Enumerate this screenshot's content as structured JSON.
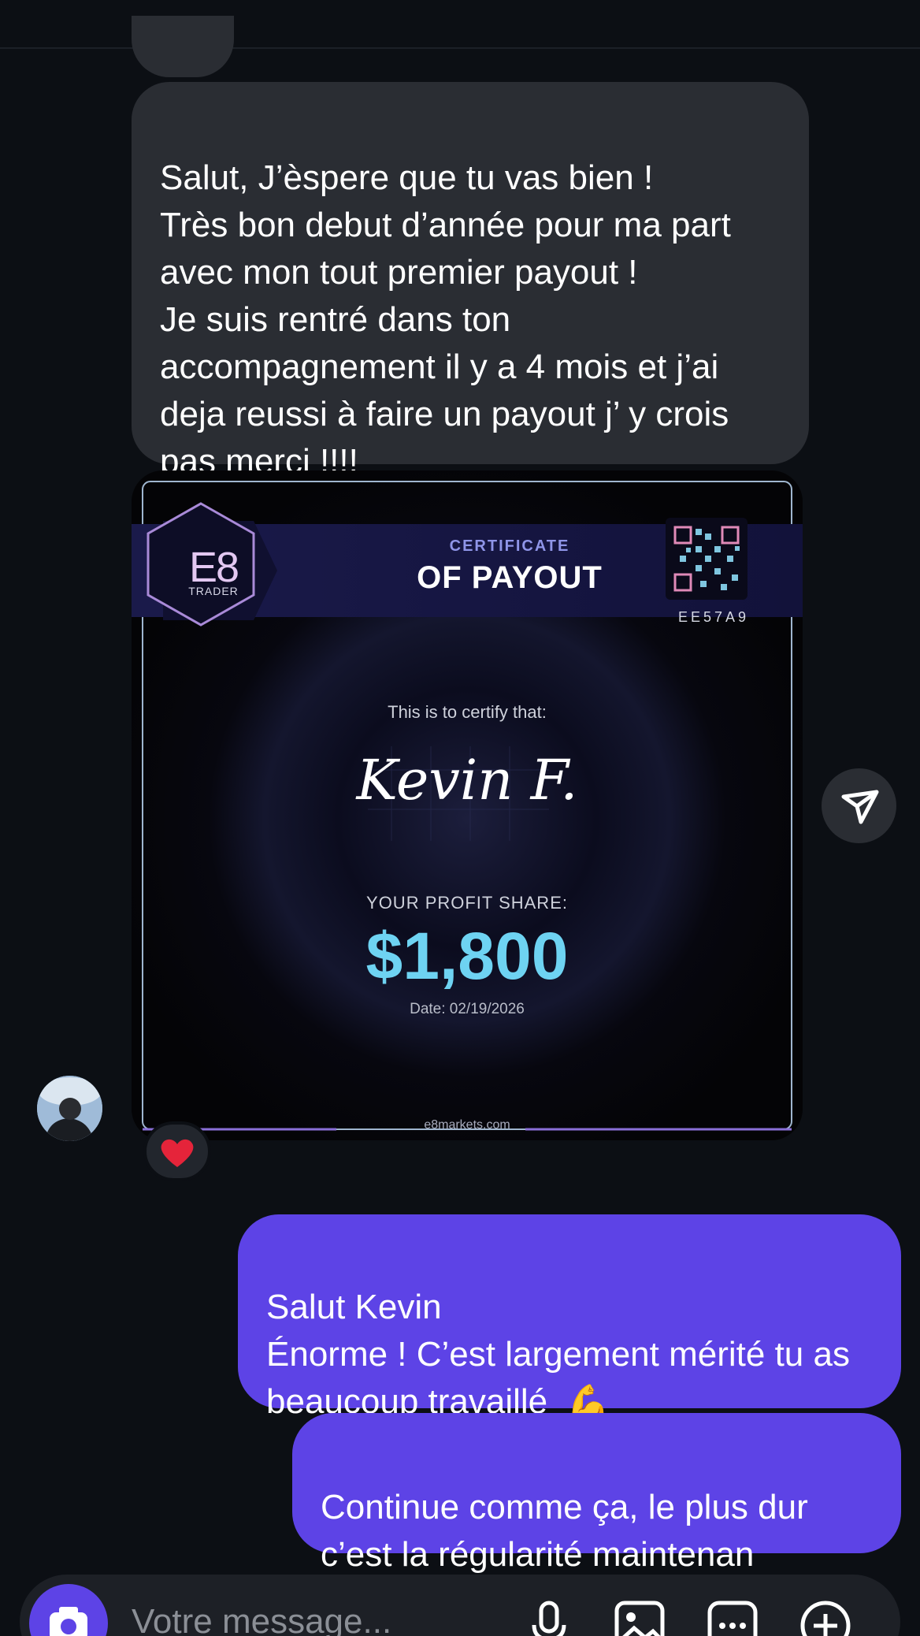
{
  "conversation": {
    "incoming_message": "Salut, J’èspere que tu vas bien !\nTrès bon debut d’année pour ma part avec mon tout premier payout !\nJe suis rentré dans ton accompagnement il y a 4 mois et j’ai deja reussi à faire un payout j’ y crois pas merci !!!!",
    "certificate": {
      "logo_text": "E8",
      "logo_sub": "TRADER",
      "title_small": "CERTIFICATE",
      "title_big": "OF PAYOUT",
      "qr_code_text": "EE57A9",
      "certify_text": "This is to certify that:",
      "signature": "Kevin F.",
      "profit_label": "YOUR PROFIT SHARE:",
      "amount": "$1,800",
      "date": "Date: 02/19/2026",
      "footer": "e8markets.com"
    },
    "reaction": "❤️",
    "outgoing_message_1": "Salut Kevin\nÉnorme ! C’est largement mérité tu as beaucoup travaillé",
    "outgoing_message_1_emoji": "💪",
    "outgoing_message_2": "Continue comme ça, le plus dur c’est la régularité maintenan"
  },
  "composer": {
    "placeholder": "Votre message..."
  },
  "icons": {
    "forward": "paper-plane-icon",
    "camera": "camera-icon",
    "mic": "microphone-icon",
    "gallery": "image-icon",
    "more": "more-icon",
    "add": "plus-circle-icon"
  },
  "colors": {
    "background": "#0c0f14",
    "incoming_bubble": "#2a2d33",
    "outgoing_bubble": "#5d43e6",
    "accent_amount": "#6ed3f2"
  }
}
